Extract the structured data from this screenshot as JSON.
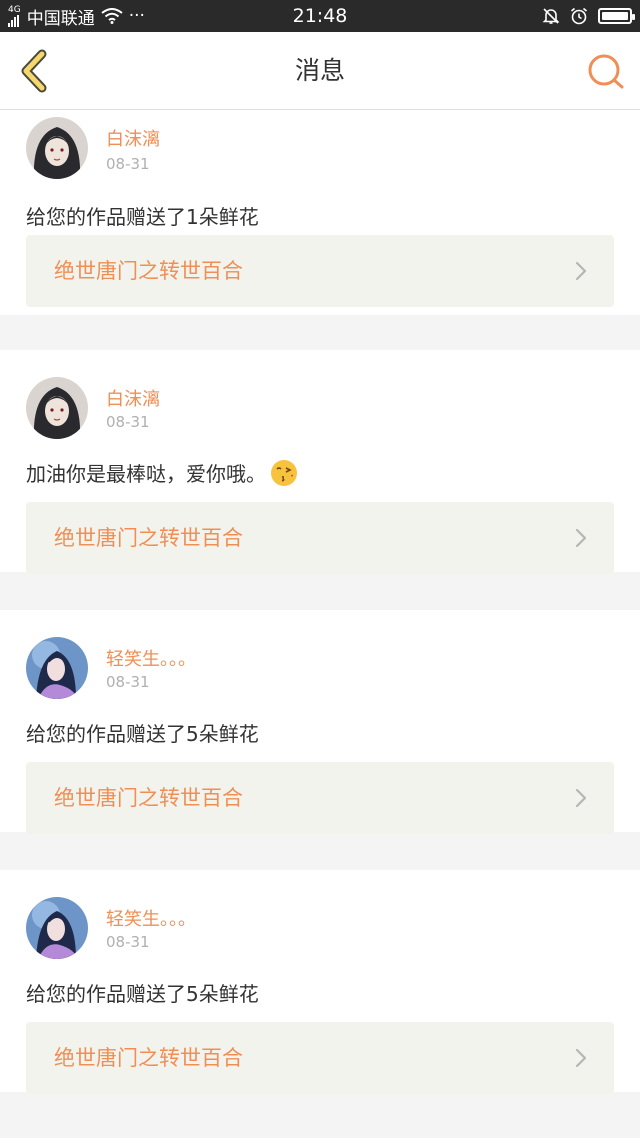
{
  "status_bar": {
    "network_type": "4G",
    "carrier": "中国联通",
    "wifi_icon": "wifi-icon",
    "more_dots": "···",
    "time": "21:48",
    "icons": [
      "bell-muted-icon",
      "alarm-icon",
      "battery-icon"
    ],
    "battery_level": 1.0
  },
  "header": {
    "back_icon": "chevron-left-icon",
    "title": "消息",
    "search_icon": "search-icon"
  },
  "messages": [
    {
      "user": "白沫漓",
      "date": "08-31",
      "text": "给您的作品赠送了1朵鲜花",
      "emoji": "",
      "work_title": "绝世唐门之转世百合"
    },
    {
      "user": "白沫漓",
      "date": "08-31",
      "text": "加油你是最棒哒，爱你哦。",
      "emoji": "😘",
      "work_title": "绝世唐门之转世百合"
    },
    {
      "user": "轻笑生。。。",
      "date": "08-31",
      "text": "给您的作品赠送了5朵鲜花",
      "emoji": "",
      "work_title": "绝世唐门之转世百合"
    },
    {
      "user": "轻笑生。。。",
      "date": "08-31",
      "text": "给您的作品赠送了5朵鲜花",
      "emoji": "",
      "work_title": "绝世唐门之转世百合"
    }
  ],
  "colors": {
    "accent": "#ef8f55",
    "back_icon_fill": "#f5d76e",
    "link_bg": "#f3f3ee",
    "page_bg": "#f4f4f4"
  }
}
